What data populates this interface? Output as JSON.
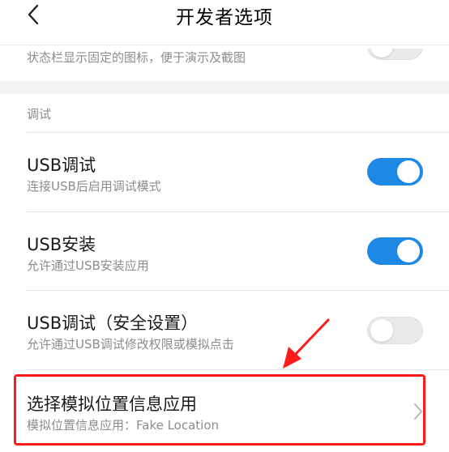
{
  "header": {
    "title": "开发者选项",
    "back_icon": "chevron-left-icon"
  },
  "top_item": {
    "subtitle": "状态栏显示固定的图标，便于演示及截图",
    "toggle_on": false
  },
  "debug_section": {
    "label": "调试",
    "items": [
      {
        "title": "USB调试",
        "subtitle": "连接USB后启用调试模式",
        "toggle_on": true
      },
      {
        "title": "USB安装",
        "subtitle": "允许通过USB安装应用",
        "toggle_on": true
      },
      {
        "title": "USB调试（安全设置）",
        "subtitle": "允许通过USB调试修改权限或模拟点击",
        "toggle_on": false
      },
      {
        "title": "选择模拟位置信息应用",
        "subtitle": "模拟位置信息应用：Fake Location",
        "chevron_icon": "chevron-right-icon"
      }
    ]
  },
  "colors": {
    "toggle_on": "#1e88e5",
    "toggle_off": "#e9e9e9",
    "annotation": "#ff1a1a",
    "section_gap": "#f2f2f2"
  }
}
